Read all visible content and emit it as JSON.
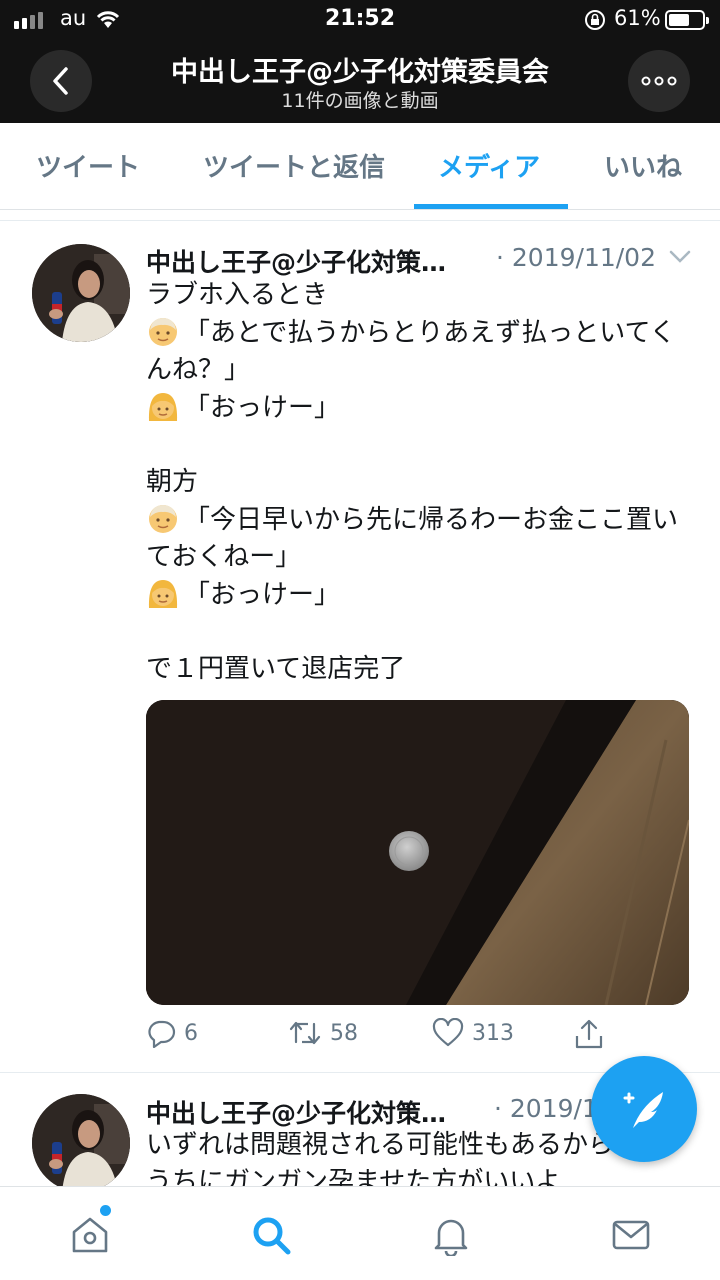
{
  "status_bar": {
    "carrier": "au",
    "time": "21:52",
    "battery": "61%",
    "battery_level": 0.61
  },
  "header": {
    "title": "中出し王子@少子化対策委員会",
    "subtitle": "11件の画像と動画"
  },
  "tabs": [
    {
      "label": "ツイート"
    },
    {
      "label": "ツイートと返信"
    },
    {
      "label": "メディア",
      "active": true
    },
    {
      "label": "いいね"
    }
  ],
  "tweets": [
    {
      "name": "中出し王子@少子化対策…",
      "date": "· 2019/11/02",
      "lines": [
        "ラブホ入るとき",
        "「あとで払うからとりあえず払っといてく",
        "んね？」",
        "「おっけー」",
        "",
        "朝方",
        "「今日早いから先に帰るわーお金ここ置い",
        "ておくねー」",
        "「おっけー」",
        "",
        "で１円置いて退店完了"
      ],
      "replies": "6",
      "retweets": "58",
      "likes": "313"
    },
    {
      "name": "中出し王子@少子化対策…",
      "date": "· 2019/1",
      "lines": [
        "いずれは問題視される可能性もあるから",
        "うちにガンガン孕ませた方がいいよ"
      ]
    }
  ],
  "icons": {
    "emoji_man": "older-man-emoji",
    "emoji_woman": "woman-emoji",
    "accent": "#1da1f2"
  }
}
